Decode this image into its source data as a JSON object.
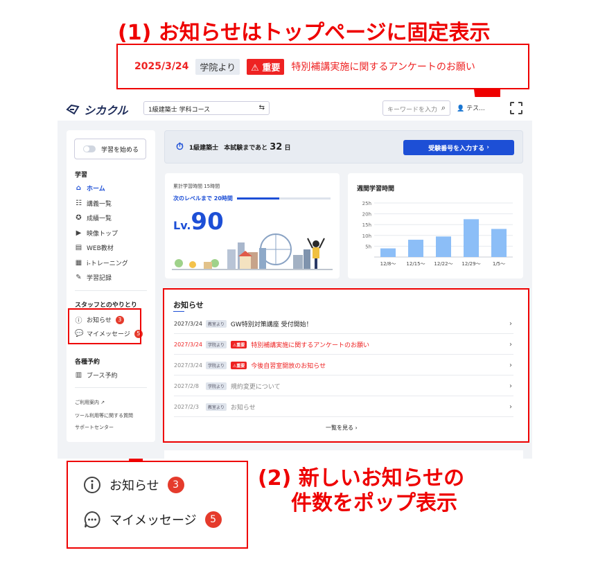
{
  "captions": {
    "caption1": "(1) お知らせはトップページに固定表示",
    "caption2_line1": "(2) 新しいお知らせの",
    "caption2_line2": "件数をポップ表示"
  },
  "pinned_notice": {
    "date": "2025/3/24",
    "tag": "学院より",
    "important": "重要",
    "title": "特別補講実施に関するアンケートのお願い"
  },
  "header": {
    "logo": "シカクル",
    "course": "1級建築士 学科コース",
    "search_placeholder": "キーワードを入力",
    "user": "テス..."
  },
  "sidebar": {
    "start_button": "学習を始める",
    "section_study": "学習",
    "items": [
      {
        "icon": "home-icon",
        "label": "ホーム",
        "active": true
      },
      {
        "icon": "lecture-list-icon",
        "label": "講義一覧"
      },
      {
        "icon": "grades-icon",
        "label": "成績一覧"
      },
      {
        "icon": "video-icon",
        "label": "映像トップ"
      },
      {
        "icon": "web-material-icon",
        "label": "WEB教材"
      },
      {
        "icon": "training-icon",
        "label": "i-トレーニング"
      },
      {
        "icon": "study-log-icon",
        "label": "学習記録"
      }
    ],
    "section_staff": "スタッフとのやりとり",
    "notices_label": "お知らせ",
    "notices_count": "3",
    "messages_label": "マイメッセージ",
    "messages_count": "5",
    "section_booking": "各種予約",
    "booth_label": "ブース予約",
    "links": [
      "ご利用案内",
      "ツール利用等に関する質問",
      "サポートセンター"
    ]
  },
  "countdown": {
    "exam": "1級建築士",
    "text": "本試験まであと",
    "days": "32",
    "unit": "日",
    "button": "受験番号を入力する"
  },
  "level": {
    "total_hours": "累計学習時間 15時間",
    "next": "次のレベルまで 20時間",
    "progress": 0.45,
    "lv_prefix": "Lv.",
    "lv_value": "90"
  },
  "chart_data": {
    "type": "bar",
    "title": "週間学習時間",
    "categories": [
      "12/8〜",
      "12/15〜",
      "12/22〜",
      "12/29〜",
      "1/5〜"
    ],
    "values": [
      4,
      8,
      9.5,
      17.5,
      13
    ],
    "yticks": [
      "5h",
      "10h",
      "15h",
      "20h",
      "25h"
    ],
    "ylim": [
      0,
      25
    ],
    "bar_color": "#8cbef7"
  },
  "notice_list": {
    "title": "お知らせ",
    "items": [
      {
        "date": "2027/3/24",
        "tag": "教室より",
        "important": "",
        "title": "GW特別対策講座 受付開始！",
        "style": "normal"
      },
      {
        "date": "2027/3/24",
        "tag": "学院より",
        "important": "重要",
        "title": "特別補講実施に関するアンケートのお願い",
        "style": "hi"
      },
      {
        "date": "2027/3/24",
        "tag": "学院より",
        "important": "重要",
        "title": "今後自習室開放のお知らせ",
        "style": "hi2"
      },
      {
        "date": "2027/2/8",
        "tag": "学院より",
        "important": "",
        "title": "規約変更について",
        "style": "gray"
      },
      {
        "date": "2027/2/3",
        "tag": "教室より",
        "important": "",
        "title": "お知らせ",
        "style": "gray"
      }
    ],
    "more": "一覧を見る"
  },
  "zoom": {
    "notices_label": "お知らせ",
    "notices_count": "3",
    "messages_label": "マイメッセージ",
    "messages_count": "5"
  }
}
